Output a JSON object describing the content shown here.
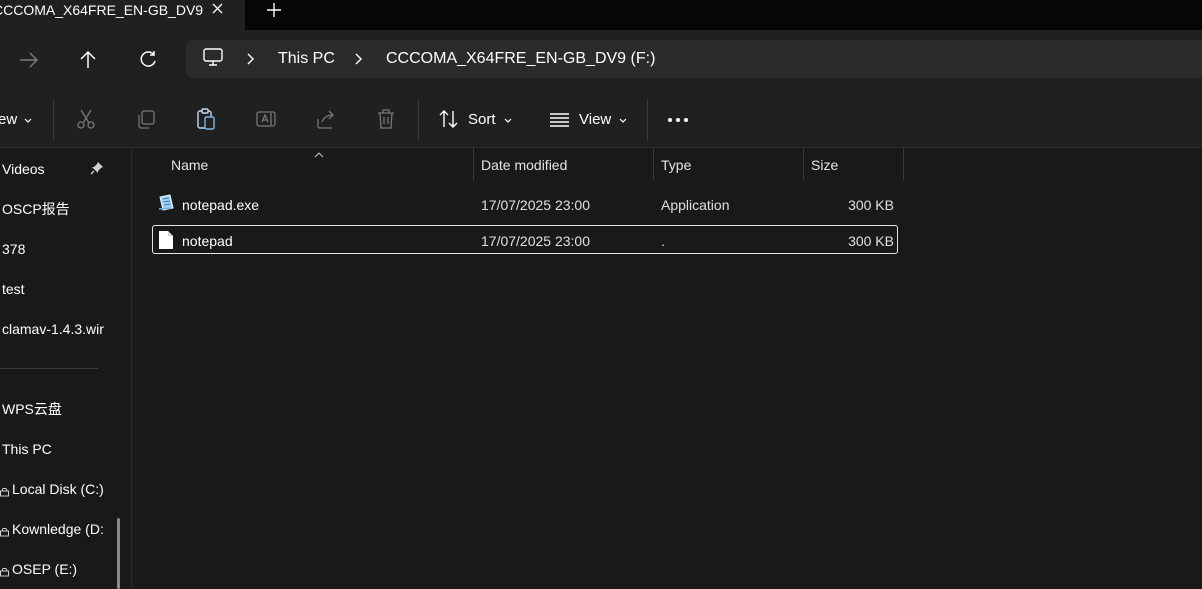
{
  "window": {
    "tab_title": "CCCOMA_X64FRE_EN-GB_DV9",
    "close_glyph": "✕",
    "new_tab_glyph": "+"
  },
  "navigation": {
    "breadcrumb": [
      "This PC",
      "CCCOMA_X64FRE_EN-GB_DV9 (F:)"
    ]
  },
  "commandbar": {
    "new_label": "ew",
    "sort_label": "Sort",
    "view_label": "View",
    "more_glyph": "•••"
  },
  "sidebar": {
    "items": [
      {
        "label": "Videos",
        "pinned": true
      },
      {
        "label": "OSCP报告"
      },
      {
        "label": "378"
      },
      {
        "label": "test"
      },
      {
        "label": "clamav-1.4.3.wir"
      },
      {
        "label": "WPS云盘"
      },
      {
        "label": "This PC"
      },
      {
        "label": "Local Disk (C:)",
        "icon": "drive-icon"
      },
      {
        "label": "Kownledge (D:",
        "icon": "drive-icon"
      },
      {
        "label": "OSEP (E:)",
        "icon": "drive-icon"
      }
    ]
  },
  "filelist": {
    "columns": [
      "Name",
      "Date modified",
      "Type",
      "Size"
    ],
    "sort_column": "Name",
    "rows": [
      {
        "name": "notepad.exe",
        "date": "17/07/2025 23:00",
        "type": "Application",
        "size": "300 KB",
        "icon": "application-icon",
        "selected": false
      },
      {
        "name": "notepad",
        "date": "17/07/2025 23:00",
        "type": ".",
        "size": "300 KB",
        "icon": "file-icon",
        "selected": true
      }
    ]
  },
  "colors": {
    "background": "#191919",
    "chrome": "#202020",
    "titlebar": "#060606",
    "address": "#2b2b2b",
    "text": "#ffffff"
  }
}
